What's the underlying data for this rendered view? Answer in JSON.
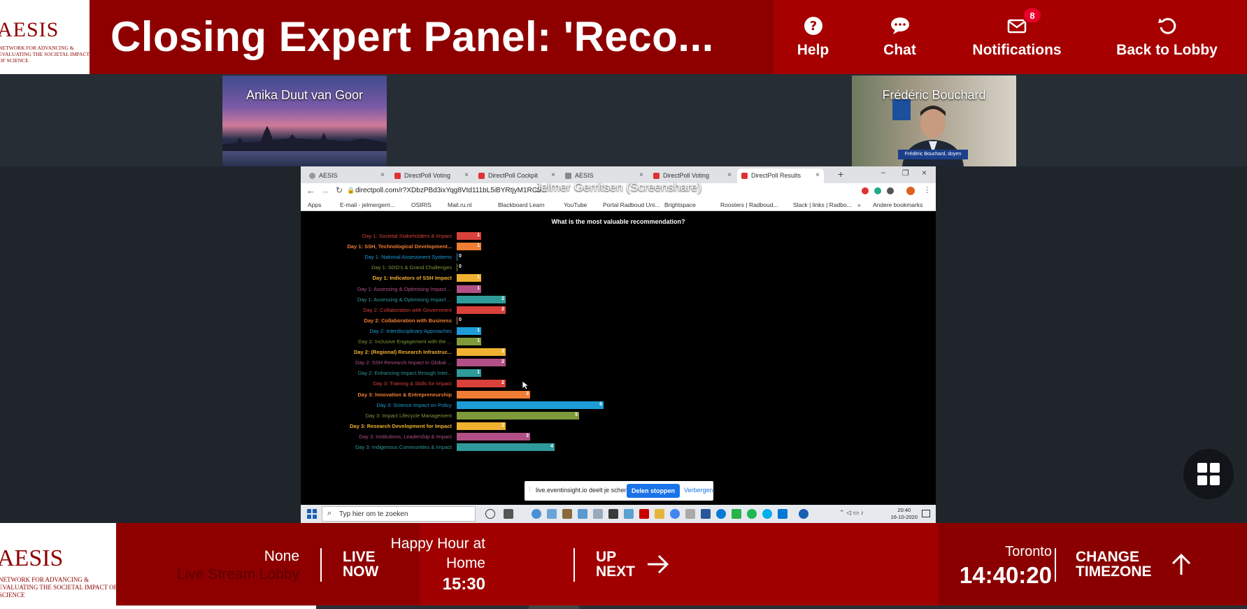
{
  "header": {
    "logo_text": "AESIS",
    "logo_sub": "NETWORK FOR ADVANCING & EVALUATING THE SOCIETAL IMPACT OF SCIENCE",
    "session_title": "Closing Expert Panel: 'Reco...",
    "nav": [
      {
        "label": "Help",
        "icon": "help-circle-icon"
      },
      {
        "label": "Chat",
        "icon": "chat-bubble-icon"
      },
      {
        "label": "Notifications",
        "icon": "envelope-icon",
        "badge": "8"
      },
      {
        "label": "Back to Lobby",
        "icon": "rotate-back-icon"
      }
    ]
  },
  "participants": [
    {
      "name": "Anika Duut van Goor"
    },
    {
      "name": "Frédéric Bouchard",
      "caption": "Frédéric Bouchard, doyen"
    }
  ],
  "screenshare": {
    "label": "Jelmer Gerritsen (Screenshare)",
    "tabs": [
      "AESIS",
      "DirectPoll Voting",
      "DirectPoll Cockpit",
      "AESIS",
      "DirectPoll Voting",
      "DirectPoll Results"
    ],
    "url": "directpoll.com/r?XDbzPBd3ixYqg8Vtd111bL5iBYRtjyM1RC5...",
    "bookmarks": [
      "Apps",
      "E-mail - jelmergerri...",
      "OSIRIS",
      "Mail.ru.nl",
      "Blackboard Learn",
      "YouTube",
      "Portal Radboud Uni...",
      "Brightspace",
      "Roosters | Radboud...",
      "Slack | links | Radbo...",
      "»",
      "Andere bookmarks"
    ],
    "share_notice": "live.eventinsight.io deelt je scherm.",
    "stop_share": "Delen stoppen",
    "hide": "Verbergen",
    "taskbar_search": "Typ hier om te zoeken",
    "time": "20:40",
    "date": "16-10-2020"
  },
  "chart_data": {
    "type": "bar",
    "title": "What is the most valuable recommendation?",
    "categories": [
      "Day 1: Societal Stakeholders & Impact",
      "Day 1: SSH, Technological Development...",
      "Day 1: National Assessment Systems",
      "Day 1: SDG's & Grand Challenges",
      "Day 1: Indicators of SSH Impact",
      "Day 1: Assessing & Optimising Impact ...",
      "Day 1: Assessing & Optimising Impact ...",
      "Day 2: Collaboration with Government",
      "Day 2: Collaboration with Business",
      "Day 2: Interdisciplinary Approaches",
      "Day 2: Inclusive Engagement with the ...",
      "Day 2: (Regional) Research Infrastruc...",
      "Day 2: SSH Research Impact in Global ...",
      "Day 2: Enhancing Impact through Inter...",
      "Day 3: Training & Skills for Impact",
      "Day 3: Innovation & Entrepreneurship",
      "Day 3: Science Impact on Policy",
      "Day 3: Impact Lifecycle Management",
      "Day 3: Research Development for Impact",
      "Day 3: Institutions, Leadership & Impact",
      "Day 3: Indigenous Communities & Impact"
    ],
    "values": [
      1,
      1,
      0,
      0,
      1,
      1,
      2,
      2,
      0,
      1,
      1,
      2,
      2,
      1,
      2,
      3,
      6,
      5,
      2,
      3,
      4
    ],
    "colors": [
      "#d9413a",
      "#f07d34",
      "#1e9cd7",
      "#7e9a3a",
      "#f0b030",
      "#b24f86",
      "#2f9a9a",
      "#d9413a",
      "#f07d34",
      "#1e9cd7",
      "#7e9a3a",
      "#f0b030",
      "#b24f86",
      "#2f9a9a",
      "#d9413a",
      "#f07d34",
      "#1e9cd7",
      "#7e9a3a",
      "#f0b030",
      "#b24f86",
      "#2f9a9a"
    ],
    "xlim": [
      0,
      6
    ]
  },
  "footer": {
    "logo_text": "AESIS",
    "logo_sub": "NETWORK FOR ADVANCING & EVALUATING THE SOCIETAL IMPACT OF SCIENCE",
    "now_title": "None",
    "now_subtitle": "Live Stream Lobby",
    "live_now": [
      "LIVE",
      "NOW"
    ],
    "next_title_1": "Happy Hour at",
    "next_title_2": "Home",
    "next_time": "15:30",
    "up_next": [
      "UP",
      "NEXT"
    ],
    "tz_city": "Toronto",
    "tz_time": "14:40:20",
    "change_tz": [
      "CHANGE",
      "TIMEZONE"
    ]
  }
}
